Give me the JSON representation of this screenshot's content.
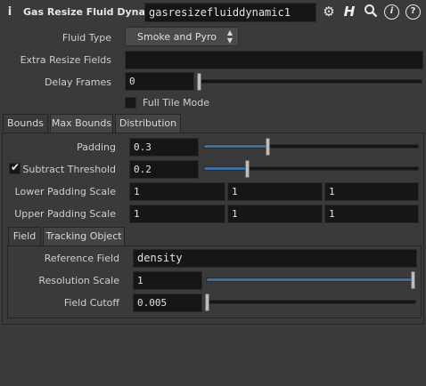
{
  "header": {
    "node_type_label": "Gas Resize Fluid Dynamic",
    "node_name": "gasresizefluiddynamic1"
  },
  "params": {
    "fluid_type_label": "Fluid Type",
    "fluid_type_value": "Smoke and Pyro",
    "extra_resize_fields_label": "Extra Resize Fields",
    "extra_resize_fields_value": "",
    "delay_frames_label": "Delay Frames",
    "delay_frames_value": "0",
    "delay_frames_level": 0.0,
    "full_tile_mode_label": "Full Tile Mode"
  },
  "tabs": {
    "bounds": "Bounds",
    "max_bounds": "Max Bounds",
    "distribution": "Distribution"
  },
  "bounds": {
    "padding_label": "Padding",
    "padding_value": "0.3",
    "padding_level": 0.3,
    "subtract_threshold_label": "Subtract Threshold",
    "subtract_threshold_value": "0.2",
    "subtract_threshold_level": 0.2,
    "lower_padding_scale_label": "Lower Padding Scale",
    "lower_padding_scale": [
      "1",
      "1",
      "1"
    ],
    "upper_padding_scale_label": "Upper Padding Scale",
    "upper_padding_scale": [
      "1",
      "1",
      "1"
    ]
  },
  "subtabs": {
    "field": "Field",
    "tracking_object": "Tracking Object"
  },
  "field": {
    "reference_field_label": "Reference Field",
    "reference_field_value": "density",
    "resolution_scale_label": "Resolution Scale",
    "resolution_scale_value": "1",
    "resolution_scale_level": 1.0,
    "field_cutoff_label": "Field Cutoff",
    "field_cutoff_value": "0.005",
    "field_cutoff_level": 0.005
  },
  "icons": [
    "info-icon",
    "gear-icon",
    "help-h-icon",
    "search-icon",
    "info-circle-icon",
    "help-circle-icon"
  ],
  "colors": {
    "background": "#3a3a3a",
    "field_bg": "#161616",
    "slider_fill": "#3d6fa0"
  }
}
